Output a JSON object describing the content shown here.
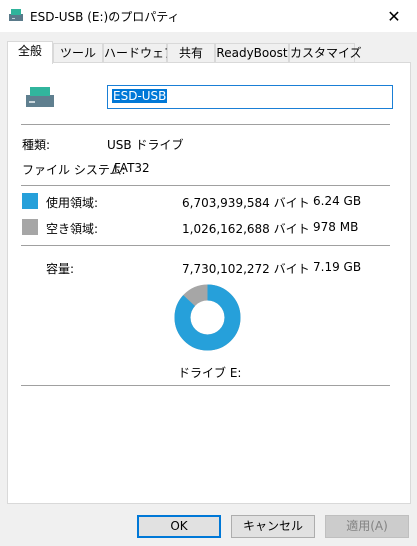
{
  "window": {
    "title": "ESD-USB (E:)のプロパティ",
    "close_glyph": "✕"
  },
  "tabs": [
    {
      "label": "全般",
      "active": true
    },
    {
      "label": "ツール"
    },
    {
      "label": "ハードウェア"
    },
    {
      "label": "共有"
    },
    {
      "label": "ReadyBoost"
    },
    {
      "label": "カスタマイズ"
    }
  ],
  "general": {
    "volume_name": "ESD-USB",
    "type_label": "種類:",
    "type_value": "USB ドライブ",
    "fs_label": "ファイル システム:",
    "fs_value": "FAT32",
    "used": {
      "label": "使用領域:",
      "bytes": "6,703,939,584 バイト",
      "size": "6.24 GB",
      "color": "#26a0da"
    },
    "free": {
      "label": "空き領域:",
      "bytes": "1,026,162,688 バイト",
      "size": "978 MB",
      "color": "#a6a6a6"
    },
    "capacity": {
      "label": "容量:",
      "bytes": "7,730,102,272 バイト",
      "size": "7.19 GB"
    },
    "drive_caption": "ドライブ E:",
    "used_fraction": 0.867
  },
  "buttons": {
    "ok": "OK",
    "cancel": "キャンセル",
    "apply": "適用(A)"
  }
}
